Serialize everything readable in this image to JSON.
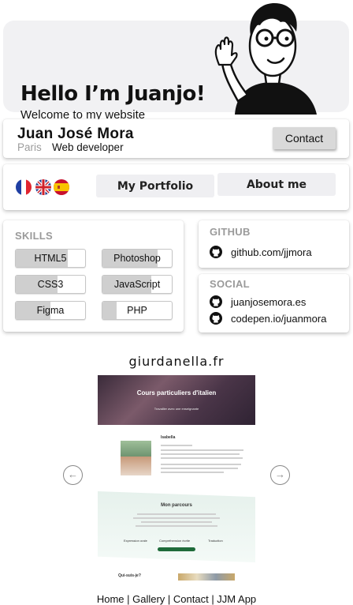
{
  "hero": {
    "title": "Hello I’m Juanjo!",
    "subtitle": "Welcome to my website"
  },
  "profile": {
    "name": "Juan José Mora",
    "city": "Paris",
    "role": "Web developer",
    "contact_label": "Contact"
  },
  "nav": {
    "languages": [
      "fr-flag-icon",
      "uk-flag-icon",
      "es-flag-icon"
    ],
    "portfolio_label": "My Portfolio",
    "about_label": "About me"
  },
  "skills": {
    "title": "SKILLS",
    "items": [
      {
        "label": "HTML5",
        "level": 0.75
      },
      {
        "label": "Photoshop",
        "level": 0.8
      },
      {
        "label": "CSS3",
        "level": 0.6
      },
      {
        "label": "JavaScript",
        "level": 0.7
      },
      {
        "label": "Figma",
        "level": 0.5
      },
      {
        "label": "PHP",
        "level": 0.2
      }
    ]
  },
  "github": {
    "title": "GITHUB",
    "link": "github.com/jjmora"
  },
  "social": {
    "title": "SOCIAL",
    "links": [
      "juanjosemora.es",
      "codepen.io/juanmora"
    ]
  },
  "gallery": {
    "title": "giurdanella.fr",
    "prev_icon": "chevron-left-icon",
    "next_icon": "chevron-right-icon",
    "preview": {
      "banner_title": "Cours particuliers d'italien",
      "banner_subtitle": "Travailler avec une enseignante",
      "person": "Isabella",
      "section_title": "Mon parcours",
      "features": [
        "Expression orale",
        "Compréhension écrite",
        "Traduction"
      ],
      "footer_label": "Qui-suis-je?"
    }
  },
  "footer": {
    "text": "Home | Gallery | Contact | JJM App"
  },
  "colors": {
    "hero_bg": "#f1f1f3",
    "button_bg": "#efeff2",
    "contact_bg": "#d9d9d9",
    "section_title": "#9a9a9a",
    "skill_fill": "#cfcfcf"
  }
}
